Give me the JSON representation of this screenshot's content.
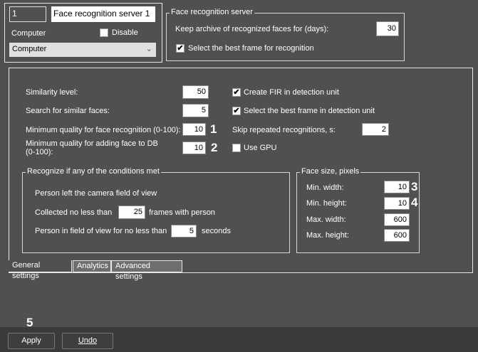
{
  "header": {
    "id_value": "1",
    "name_value": "Face recognition server 1",
    "computer_label": "Computer",
    "disable_label": "Disable",
    "disable_checked": false,
    "computer_select": "Computer"
  },
  "server_group": {
    "title": "Face recognition server",
    "keep_archive_label": "Keep archive of recognized faces for (days):",
    "keep_archive_value": "30",
    "best_frame_label": "Select the best frame for recognition",
    "best_frame_checked": true
  },
  "general": {
    "similarity_label": "Similarity level:",
    "similarity_value": "50",
    "search_label": "Search for similar faces:",
    "search_value": "5",
    "min_quality_label": "Minimum quality for face recognition (0-100):",
    "min_quality_value": "10",
    "min_quality_db_label_1": "Minimum quality for adding face to DB",
    "min_quality_db_label_2": "(0-100):",
    "min_quality_db_value": "10",
    "create_fir_label": "Create FIR in detection unit",
    "create_fir_checked": true,
    "best_frame_unit_label": "Select the best frame in detection unit",
    "best_frame_unit_checked": true,
    "skip_label": "Skip repeated recognitions, s:",
    "skip_value": "2",
    "gpu_label": "Use GPU",
    "gpu_checked": false
  },
  "conditions": {
    "title": "Recognize if any of the conditions met",
    "left_fov": "Person left the camera field of view",
    "collected_label": "Collected no less than",
    "collected_value": "25",
    "collected_suffix": "frames with person",
    "person_label": "Person in field of view for no less than",
    "person_value": "5",
    "person_suffix": "seconds"
  },
  "face_size": {
    "title": "Face size, pixels",
    "rows": [
      {
        "label": "Min. width:",
        "value": "10"
      },
      {
        "label": "Min. height:",
        "value": "10"
      },
      {
        "label": "Max. width:",
        "value": "600"
      },
      {
        "label": "Max. height:",
        "value": "600"
      }
    ]
  },
  "callouts": [
    "1",
    "2",
    "3",
    "4",
    "5"
  ],
  "tabs": [
    "General settings",
    "Analytics",
    "Advanced settings"
  ],
  "footer": {
    "apply": "Apply",
    "undo": "Undo"
  }
}
